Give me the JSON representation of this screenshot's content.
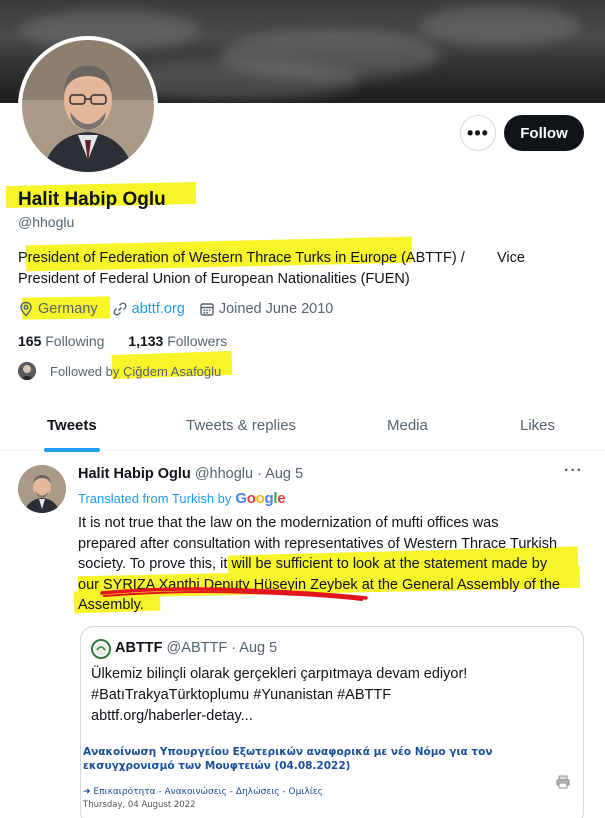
{
  "profile": {
    "name": "Halit Habip Oglu",
    "handle": "@hhoglu",
    "bio_line1": "President of Federation of Western Thrace Turks in Europe (ABTTF) /        Vice",
    "bio_line2": "President of Federal Union of European Nationalities (FUEN)",
    "location": "Germany",
    "website": "abttf.org",
    "joined": "Joined June 2010",
    "following_count": "165",
    "following_label": "Following",
    "followers_count": "1,133",
    "followers_label": "Followers",
    "followed_by": "Followed by Çiğdem Asafoğlu",
    "follow_label": "Follow",
    "more_label": "•••"
  },
  "tabs": [
    {
      "label": "Tweets"
    },
    {
      "label": "Tweets & replies"
    },
    {
      "label": "Media"
    },
    {
      "label": "Likes"
    }
  ],
  "tweet": {
    "author": "Halit Habip Oglu",
    "meta": "@hhoglu · Aug 5",
    "more": "···",
    "translated": "Translated from Turkish by",
    "text_line1": "It is not true that the law on the modernization of mufti offices was",
    "text_line2": "prepared after consultation with representatives of Western Thrace Turkish",
    "text_line3": "society. To prove this, it will be sufficient to look at the statement made by",
    "text_line4": "our SYRIZA Xanthi Deputy Hüseyin Zeybek at the General Assembly of the",
    "text_line5": "Assembly."
  },
  "quote": {
    "author": "ABTTF",
    "meta": "@ABTTF · Aug 5",
    "line1": "Ülkemiz bilinçli olarak gerçekleri çarpıtmaya devam ediyor!",
    "line2": "#BatıTrakyaTürktoplumu #Yunanistan #ABTTF",
    "line3": "abttf.org/haberler-detay...",
    "card_title": "Ανακοίνωση Υπουργείου Εξωτερικών αναφορικά με νέο Νόμο για τον εκσυγχρονισμό των Μουφτειών (04.08.2022)",
    "card_categories": "Επικαιρότητα - Ανακοινώσεις - Δηλώσεις - Ομιλίες",
    "card_date": "Thursday, 04 August 2022"
  },
  "colors": {
    "accent": "#1d9bf0",
    "highlight": "#f7f52a",
    "annotation_red": "#e3141b",
    "follow_button": "#0f1419"
  }
}
